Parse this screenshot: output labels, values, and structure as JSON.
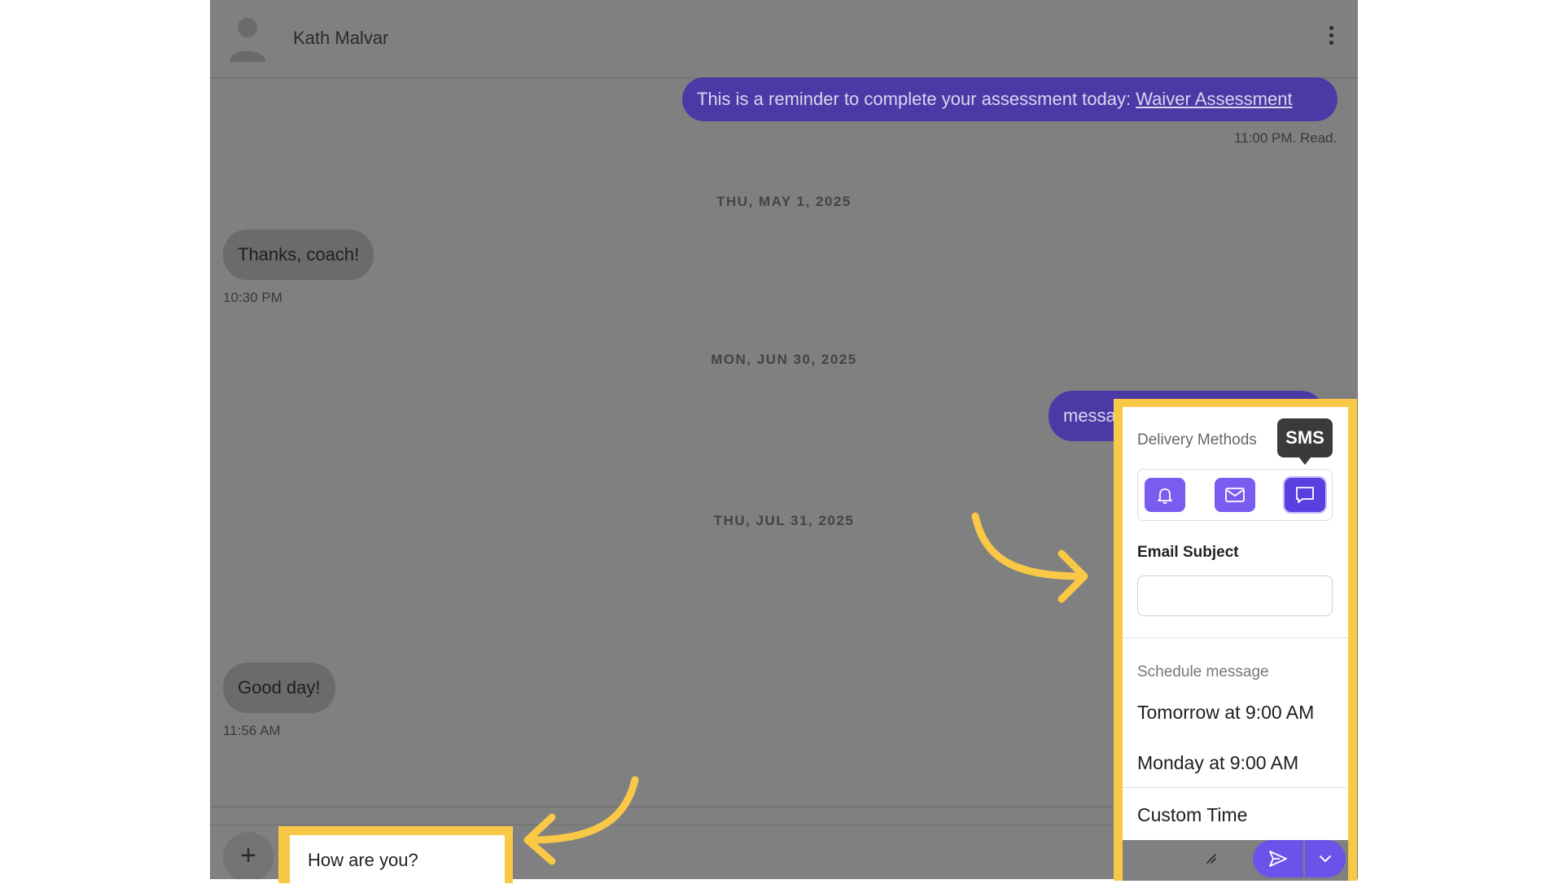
{
  "header": {
    "contact_name": "Kath Malvar"
  },
  "messages": {
    "reminder_text": "This is a reminder to complete your assessment today: ",
    "reminder_link": "Waiver Assessment",
    "reminder_meta": "11:00 PM. Read.",
    "date_1": "THU, MAY 1, 2025",
    "thanks_text": "Thanks, coach!",
    "thanks_time": "10:30 PM",
    "date_2": "MON, JUN 30, 2025",
    "partial_out_text": "messa",
    "date_3": "THU, JUL 31, 2025",
    "goodday_text": "Good day!",
    "goodday_time": "11:56 AM"
  },
  "composer": {
    "plus_label": "+",
    "input_value": "How are you?"
  },
  "panel": {
    "delivery_methods_label": "Delivery Methods",
    "tooltip_text": "SMS",
    "methods": [
      "bell-icon",
      "envelope-icon",
      "chat-icon"
    ],
    "email_subject_label": "Email Subject",
    "email_subject_value": "",
    "schedule_label": "Schedule message",
    "schedule_options": [
      "Tomorrow at 9:00 AM",
      "Monday at 9:00 AM"
    ],
    "custom_time_label": "Custom Time"
  },
  "colors": {
    "highlight": "#f9c846",
    "accent": "#6b52e8",
    "overlay_bg": "#808080"
  }
}
